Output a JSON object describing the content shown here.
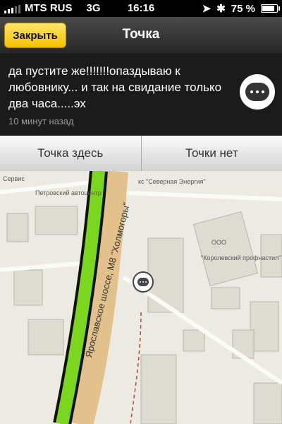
{
  "status": {
    "carrier": "MTS RUS",
    "network": "3G",
    "time": "16:16",
    "battery": "75 %",
    "battery_level": 0.75
  },
  "nav": {
    "close_label": "Закрыть",
    "title": "Точка"
  },
  "message": {
    "text": "да пустите же!!!!!!!опаздываю к любовнику... и так на свидание только два часа.....эх",
    "time_ago": "10 минут назад"
  },
  "actions": {
    "here_label": "Точка здесь",
    "no_label": "Точки нет"
  },
  "map": {
    "labels": {
      "servis": "Сервис",
      "petro": "Петровский автоцентр",
      "energy": "кс \"Северная Энергия\"",
      "ooo": "ООО",
      "korol": "\"Королевский профнастил\"",
      "road": "Ярославское шоссе, М8 \"Холмогоры\""
    }
  }
}
